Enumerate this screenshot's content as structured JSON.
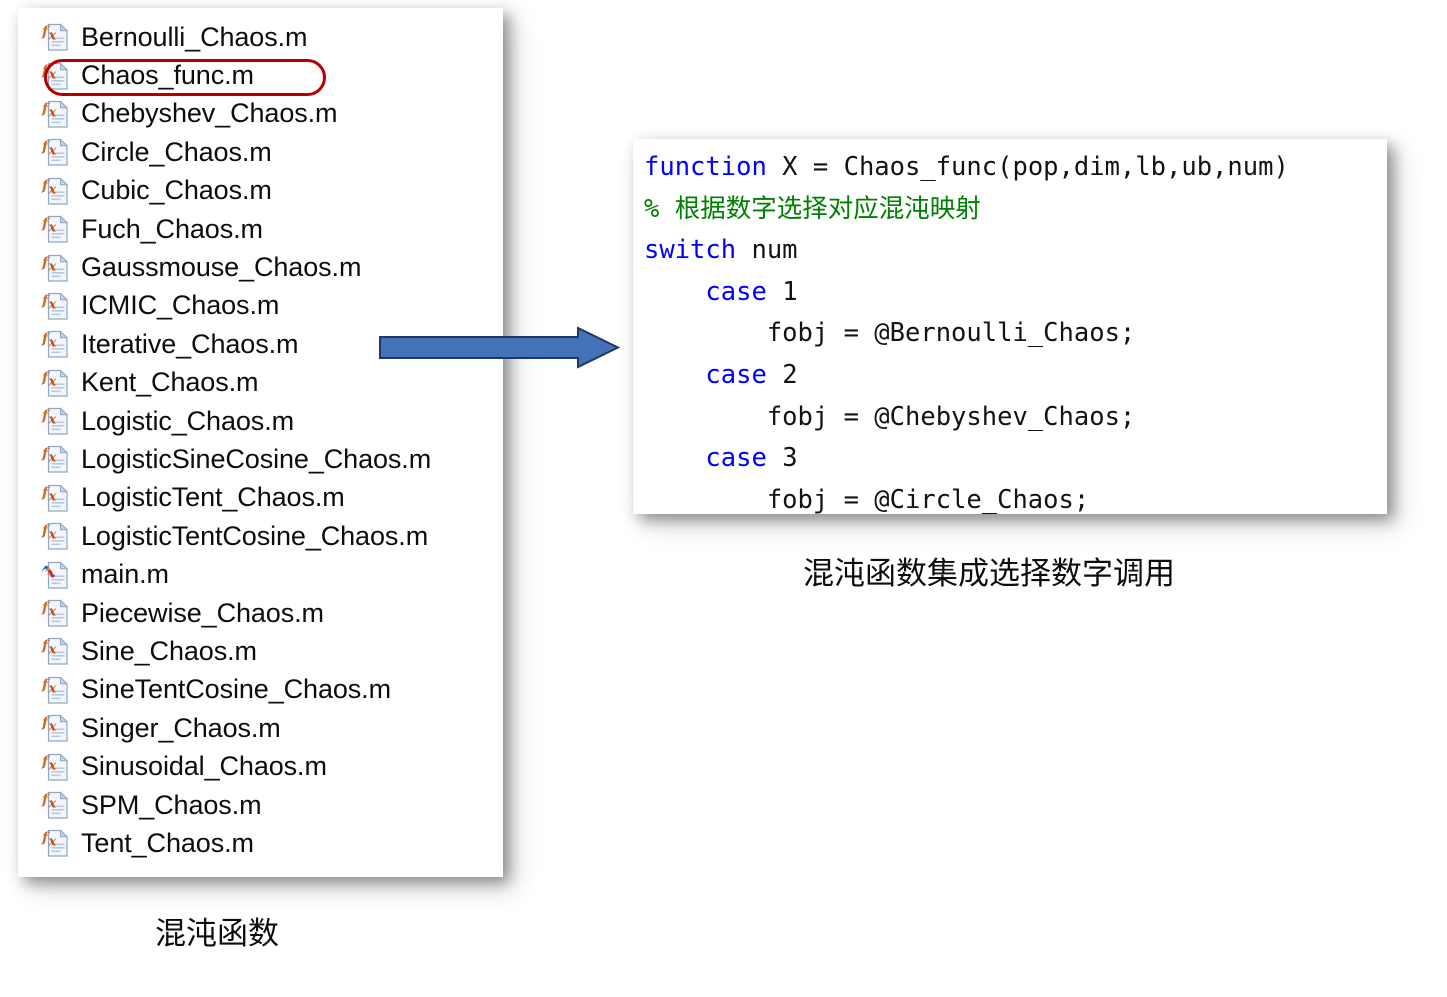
{
  "file_browser": {
    "name": "chaos-function-file-list",
    "selected_file": "Chaos_func.m",
    "files": [
      {
        "name": "Bernoulli_Chaos.m",
        "icon": "matlab-function-file-icon"
      },
      {
        "name": "Chaos_func.m",
        "icon": "matlab-function-file-icon"
      },
      {
        "name": "Chebyshev_Chaos.m",
        "icon": "matlab-function-file-icon"
      },
      {
        "name": "Circle_Chaos.m",
        "icon": "matlab-function-file-icon"
      },
      {
        "name": "Cubic_Chaos.m",
        "icon": "matlab-function-file-icon"
      },
      {
        "name": "Fuch_Chaos.m",
        "icon": "matlab-function-file-icon"
      },
      {
        "name": "Gaussmouse_Chaos.m",
        "icon": "matlab-function-file-icon"
      },
      {
        "name": "ICMIC_Chaos.m",
        "icon": "matlab-function-file-icon"
      },
      {
        "name": "Iterative_Chaos.m",
        "icon": "matlab-function-file-icon"
      },
      {
        "name": "Kent_Chaos.m",
        "icon": "matlab-function-file-icon"
      },
      {
        "name": "Logistic_Chaos.m",
        "icon": "matlab-function-file-icon"
      },
      {
        "name": "LogisticSineCosine_Chaos.m",
        "icon": "matlab-function-file-icon"
      },
      {
        "name": "LogisticTent_Chaos.m",
        "icon": "matlab-function-file-icon"
      },
      {
        "name": "LogisticTentCosine_Chaos.m",
        "icon": "matlab-function-file-icon"
      },
      {
        "name": "main.m",
        "icon": "matlab-script-file-icon"
      },
      {
        "name": "Piecewise_Chaos.m",
        "icon": "matlab-function-file-icon"
      },
      {
        "name": "Sine_Chaos.m",
        "icon": "matlab-function-file-icon"
      },
      {
        "name": "SineTentCosine_Chaos.m",
        "icon": "matlab-function-file-icon"
      },
      {
        "name": "Singer_Chaos.m",
        "icon": "matlab-function-file-icon"
      },
      {
        "name": "Sinusoidal_Chaos.m",
        "icon": "matlab-function-file-icon"
      },
      {
        "name": "SPM_Chaos.m",
        "icon": "matlab-function-file-icon"
      },
      {
        "name": "Tent_Chaos.m",
        "icon": "matlab-function-file-icon"
      }
    ]
  },
  "code_panel": {
    "language": "matlab",
    "lines": [
      [
        {
          "t": "function",
          "c": "kw"
        },
        {
          "t": " X = Chaos_func(pop,dim,lb,ub,num)",
          "c": "txt"
        }
      ],
      [
        {
          "t": "% 根据数字选择对应混沌映射",
          "c": "cmt"
        }
      ],
      [
        {
          "t": "switch",
          "c": "kw"
        },
        {
          "t": " num",
          "c": "txt"
        }
      ],
      [
        {
          "t": "    ",
          "c": "txt"
        },
        {
          "t": "case",
          "c": "kw"
        },
        {
          "t": " 1",
          "c": "txt"
        }
      ],
      [
        {
          "t": "        fobj = @Bernoulli_Chaos;",
          "c": "txt"
        }
      ],
      [
        {
          "t": "    ",
          "c": "txt"
        },
        {
          "t": "case",
          "c": "kw"
        },
        {
          "t": " 2",
          "c": "txt"
        }
      ],
      [
        {
          "t": "        fobj = @Chebyshev_Chaos;",
          "c": "txt"
        }
      ],
      [
        {
          "t": "    ",
          "c": "txt"
        },
        {
          "t": "case",
          "c": "kw"
        },
        {
          "t": " 3",
          "c": "txt"
        }
      ],
      [
        {
          "t": "        fobj = @Circle_Chaos;",
          "c": "txt"
        }
      ]
    ]
  },
  "captions": {
    "code": "混沌函数集成选择数字调用",
    "files": "混沌函数"
  },
  "colors": {
    "keyword": "#0000ff",
    "comment": "#008000",
    "code_text": "#131313",
    "selection_outline": "#b40000",
    "arrow_fill": "#4472b8",
    "arrow_stroke": "#1f3864"
  }
}
